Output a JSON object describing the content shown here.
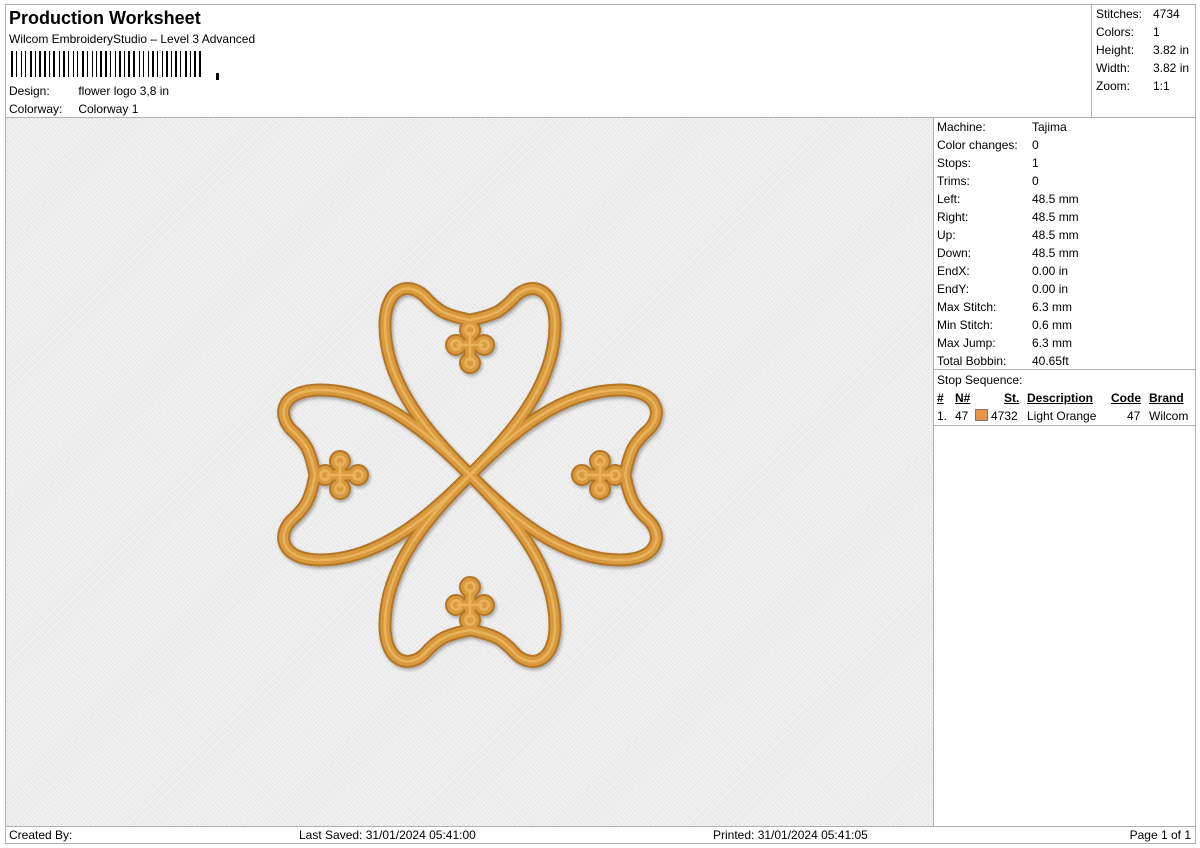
{
  "header": {
    "title": "Production Worksheet",
    "software": "Wilcom EmbroideryStudio – Level 3 Advanced",
    "design_label": "Design:",
    "design_value": "flower logo 3,8 in",
    "colorway_label": "Colorway:",
    "colorway_value": "Colorway 1"
  },
  "summary": [
    {
      "label": "Stitches:",
      "value": "4734"
    },
    {
      "label": "Colors:",
      "value": "1"
    },
    {
      "label": "Height:",
      "value": "3.82 in"
    },
    {
      "label": "Width:",
      "value": "3.82 in"
    },
    {
      "label": "Zoom:",
      "value": "1:1"
    }
  ],
  "stats": [
    {
      "label": "Machine:",
      "value": "Tajima"
    },
    {
      "label": "Color changes:",
      "value": "0"
    },
    {
      "label": "Stops:",
      "value": "1"
    },
    {
      "label": "Trims:",
      "value": "0"
    },
    {
      "label": "Left:",
      "value": "48.5 mm"
    },
    {
      "label": "Right:",
      "value": "48.5 mm"
    },
    {
      "label": "Up:",
      "value": "48.5 mm"
    },
    {
      "label": "Down:",
      "value": "48.5 mm"
    },
    {
      "label": "EndX:",
      "value": "0.00 in"
    },
    {
      "label": "EndY:",
      "value": "0.00 in"
    },
    {
      "label": "Max Stitch:",
      "value": "6.3 mm"
    },
    {
      "label": "Min Stitch:",
      "value": "0.6 mm"
    },
    {
      "label": "Max Jump:",
      "value": "6.3 mm"
    },
    {
      "label": "Total Bobbin:",
      "value": "40.65ft"
    }
  ],
  "stop_sequence": {
    "title": "Stop Sequence:",
    "headers": {
      "num": "#",
      "needle": "N#",
      "stitches": "St.",
      "description": "Description",
      "code": "Code",
      "brand": "Brand"
    },
    "rows": [
      {
        "num": "1.",
        "needle": "47",
        "stitches": "4732",
        "description": "Light Orange",
        "code": "47",
        "brand": "Wilcom",
        "color": "#e8944a"
      }
    ]
  },
  "footer": {
    "created_by": "Created By:",
    "last_saved": "Last Saved: 31/01/2024 05:41:00",
    "printed": "Printed: 31/01/2024 05:41:05",
    "page": "Page 1 of 1"
  },
  "colors": {
    "thread": "#d99a3e",
    "thread_dark": "#b37426",
    "thread_light": "#f0be6a",
    "swatch": "#e8944a",
    "canvas": "#ebebeb"
  },
  "icons": {
    "barcode": "barcode-icon",
    "design": "embroidery-design-icon",
    "swatch": "color-swatch-icon"
  }
}
